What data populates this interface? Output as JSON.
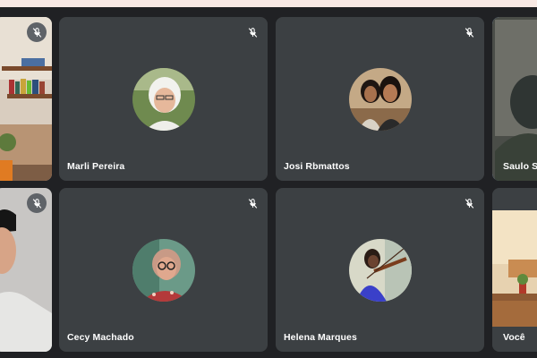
{
  "meeting": {
    "participants": [
      {
        "name": "Marli Pereira",
        "muted": true,
        "video": false
      },
      {
        "name": "Josi Rbmattos",
        "muted": true,
        "video": false
      },
      {
        "name": "Saulo Sa",
        "muted": false,
        "video": true,
        "speaking": true
      },
      {
        "name": "Cecy Machado",
        "muted": true,
        "video": false
      },
      {
        "name": "Helena Marques",
        "muted": true,
        "video": false
      },
      {
        "name": "Você",
        "muted": false,
        "video": true
      }
    ],
    "edge_tiles": [
      {
        "muted": true,
        "video": true
      },
      {
        "muted": true,
        "video": true
      }
    ]
  },
  "colors": {
    "background": "#202124",
    "tile": "#3c4043",
    "speaking_border": "#8ab4f8",
    "mic_button": "#5f6368"
  },
  "icons": {
    "mute": "mic-off-icon"
  }
}
